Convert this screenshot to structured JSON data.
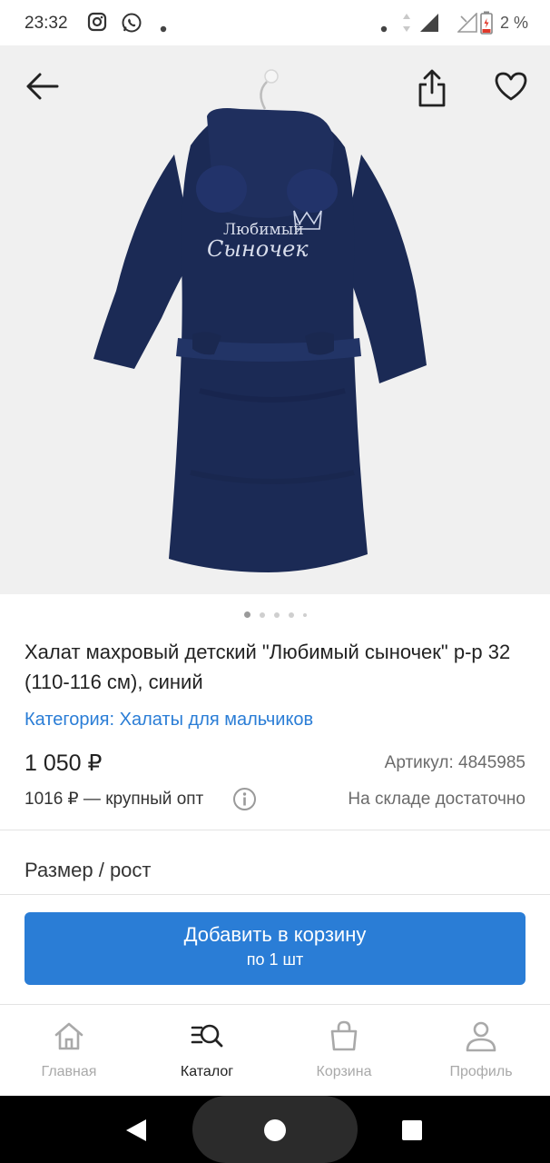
{
  "status_bar": {
    "time": "23:32",
    "battery_percent": "2 %",
    "notification_icons": [
      "instagram-icon",
      "whatsapp-icon",
      "dot-icon"
    ],
    "system_icons": [
      "dot-icon",
      "data-arrows-icon",
      "signal-icon",
      "signal-empty-icon",
      "battery-low-icon"
    ]
  },
  "product": {
    "gallery": {
      "image_count": 5,
      "active_index": 0,
      "image_text_line1": "Любимый",
      "image_text_line2": "Сыночек"
    },
    "title": "Халат махровый детский \"Любимый сыночек\" р-р 32 (110-116 см), синий",
    "category": "Категория: Халаты для мальчиков",
    "price": "1 050 ₽",
    "sku": "Артикул: 4845985",
    "wholesale": "1016 ₽ — крупный опт",
    "stock": "На складе достаточно",
    "size_label": "Размер / рост"
  },
  "cart_button": {
    "label": "Добавить в корзину",
    "sublabel": "по 1 шт"
  },
  "bottom_nav": [
    {
      "label": "Главная",
      "icon": "home-icon",
      "active": false
    },
    {
      "label": "Каталог",
      "icon": "catalog-search-icon",
      "active": true
    },
    {
      "label": "Корзина",
      "icon": "cart-bag-icon",
      "active": false
    },
    {
      "label": "Профиль",
      "icon": "profile-icon",
      "active": false
    }
  ],
  "colors": {
    "accent": "#2a7dd6",
    "robe": "#1b2a55",
    "hero_background": "#f0f0f0",
    "nav_active": "#222222",
    "nav_inactive": "#a9a9a9"
  }
}
